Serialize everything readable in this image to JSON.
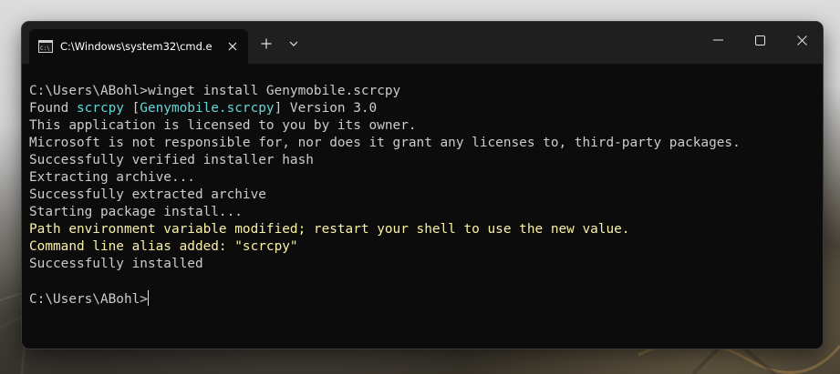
{
  "window": {
    "tab_title": "C:\\Windows\\system32\\cmd.e",
    "icons": {
      "tab": "cmd-icon",
      "tab_close": "close-icon",
      "new_tab": "plus-icon",
      "dropdown": "chevron-down-icon",
      "minimize": "minimize-icon",
      "maximize": "maximize-icon",
      "close": "close-icon"
    }
  },
  "colors": {
    "terminal_bg": "#0c0c0c",
    "titlebar_bg": "#1f1f1f",
    "text": "#cccccc",
    "highlight_cyan": "#61d6d6",
    "warning_yellow": "#f9f1a5"
  },
  "terminal": {
    "lines": [
      {
        "segments": [
          {
            "text": "C:\\Users\\ABohl>winget install Genymobile.scrcpy",
            "style": "normal"
          }
        ]
      },
      {
        "segments": [
          {
            "text": "Found ",
            "style": "normal"
          },
          {
            "text": "scrcpy",
            "style": "cyan"
          },
          {
            "text": " [",
            "style": "normal"
          },
          {
            "text": "Genymobile.scrcpy",
            "style": "cyan"
          },
          {
            "text": "] Version 3.0",
            "style": "normal"
          }
        ]
      },
      {
        "segments": [
          {
            "text": "This application is licensed to you by its owner.",
            "style": "normal"
          }
        ]
      },
      {
        "segments": [
          {
            "text": "Microsoft is not responsible for, nor does it grant any licenses to, third-party packages.",
            "style": "normal"
          }
        ]
      },
      {
        "segments": [
          {
            "text": "Successfully verified installer hash",
            "style": "normal"
          }
        ]
      },
      {
        "segments": [
          {
            "text": "Extracting archive...",
            "style": "normal"
          }
        ]
      },
      {
        "segments": [
          {
            "text": "Successfully extracted archive",
            "style": "normal"
          }
        ]
      },
      {
        "segments": [
          {
            "text": "Starting package install...",
            "style": "normal"
          }
        ]
      },
      {
        "segments": [
          {
            "text": "Path environment variable modified; restart your shell to use the new value.",
            "style": "yellow"
          }
        ]
      },
      {
        "segments": [
          {
            "text": "Command line alias added: \"scrcpy\"",
            "style": "yellow"
          }
        ]
      },
      {
        "segments": [
          {
            "text": "Successfully installed",
            "style": "normal"
          }
        ]
      },
      {
        "segments": [
          {
            "text": "",
            "style": "normal"
          }
        ]
      },
      {
        "segments": [
          {
            "text": "C:\\Users\\ABohl>",
            "style": "normal"
          }
        ],
        "cursor": true
      }
    ]
  }
}
